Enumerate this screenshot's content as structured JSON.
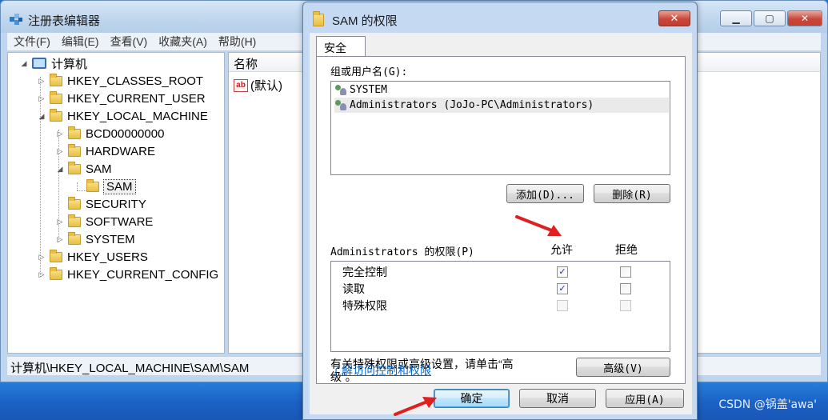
{
  "regedit": {
    "title": "注册表编辑器",
    "menu": [
      "文件(F)",
      "编辑(E)",
      "查看(V)",
      "收藏夹(A)",
      "帮助(H)"
    ],
    "tree": {
      "root": "计算机",
      "nodes": [
        {
          "label": "HKEY_CLASSES_ROOT",
          "expander": "▷"
        },
        {
          "label": "HKEY_CURRENT_USER",
          "expander": "▷"
        },
        {
          "label": "HKEY_LOCAL_MACHINE",
          "expander": "◢"
        },
        {
          "label": "BCD00000000",
          "expander": "▷"
        },
        {
          "label": "HARDWARE",
          "expander": "▷"
        },
        {
          "label": "SAM",
          "expander": "◢"
        },
        {
          "label": "SAM",
          "expander": ""
        },
        {
          "label": "SECURITY",
          "expander": ""
        },
        {
          "label": "SOFTWARE",
          "expander": "▷"
        },
        {
          "label": "SYSTEM",
          "expander": "▷"
        },
        {
          "label": "HKEY_USERS",
          "expander": "▷"
        },
        {
          "label": "HKEY_CURRENT_CONFIG",
          "expander": "▷"
        }
      ]
    },
    "values_header": "名称",
    "value_default": "(默认)",
    "value_icon_text": "ab",
    "status_path": "计算机\\HKEY_LOCAL_MACHINE\\SAM\\SAM"
  },
  "dialog": {
    "title": "SAM 的权限",
    "tab": "安全",
    "group_label": "组或用户名(G):",
    "users": [
      "SYSTEM",
      "Administrators (JoJo-PC\\Administrators)"
    ],
    "add_button": "添加(D)...",
    "remove_button": "删除(R)",
    "perm_label": "Administrators 的权限(P)",
    "allow_header": "允许",
    "deny_header": "拒绝",
    "permissions": [
      {
        "name": "完全控制",
        "allow": "✓",
        "deny": ""
      },
      {
        "name": "读取",
        "allow": "✓",
        "deny": ""
      },
      {
        "name": "特殊权限",
        "allow": "",
        "deny": ""
      }
    ],
    "special_text_1": "有关特殊权限或高级设置，请单击“高",
    "special_text_2": "级”。",
    "advanced_button": "高级(V)",
    "learn_link": "了解访问控制和权限",
    "ok_button": "确定",
    "cancel_button": "取消",
    "apply_button": "应用(A)"
  },
  "watermark": "CSDN @锅盖'awa'",
  "colors": {
    "arrow": "#e02020",
    "link": "#0066cc"
  }
}
